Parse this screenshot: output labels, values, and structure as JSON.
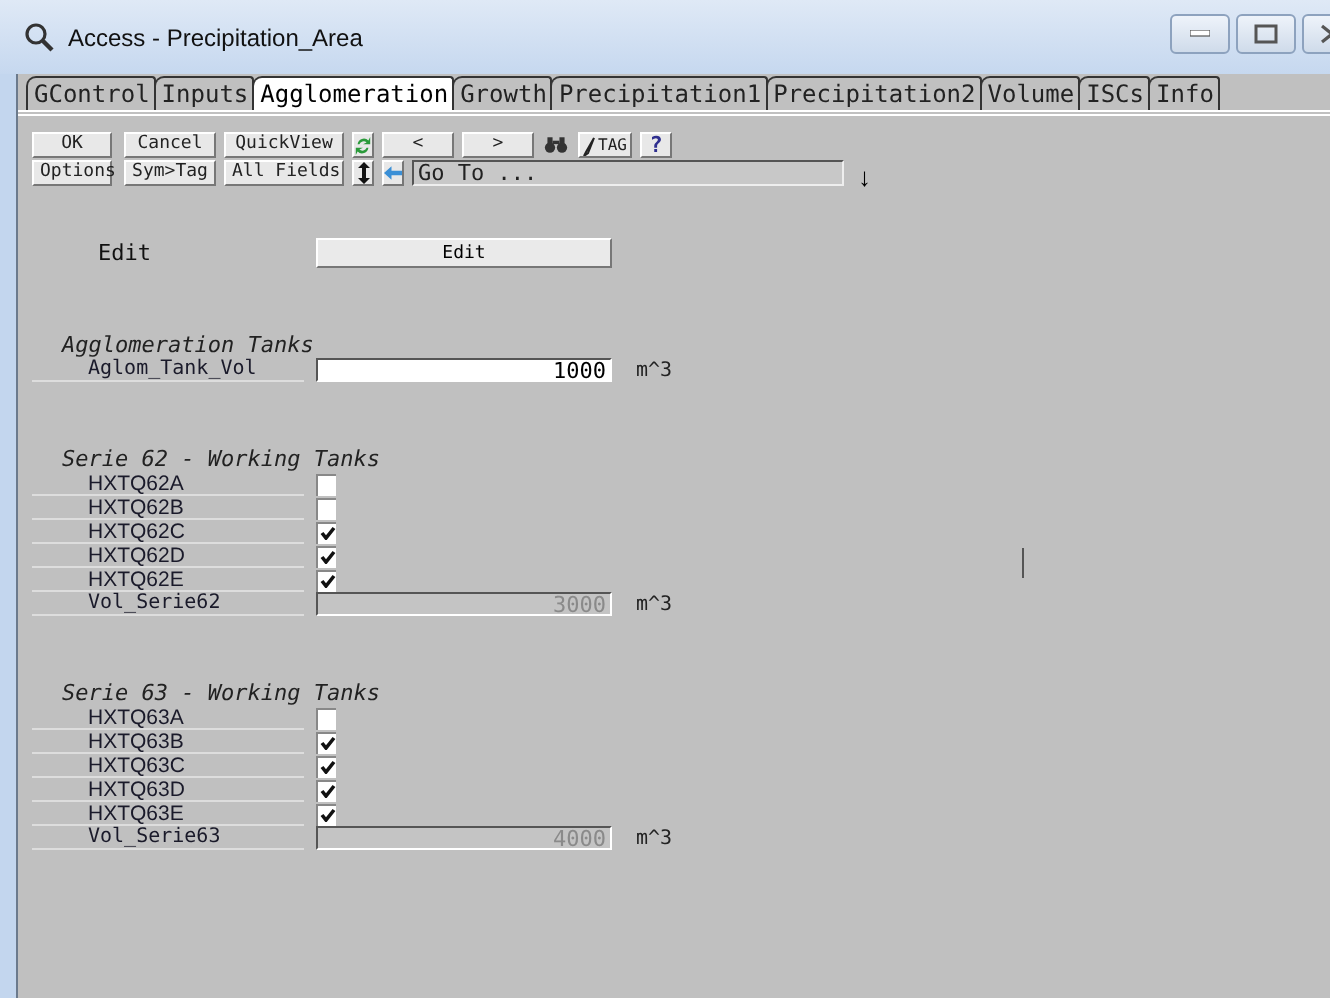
{
  "window": {
    "title": "Access - Precipitation_Area"
  },
  "tabs": [
    {
      "label": "GControl",
      "selected": false
    },
    {
      "label": "Inputs",
      "selected": false
    },
    {
      "label": "Agglomeration",
      "selected": true
    },
    {
      "label": "Growth",
      "selected": false
    },
    {
      "label": "Precipitation1",
      "selected": false
    },
    {
      "label": "Precipitation2",
      "selected": false
    },
    {
      "label": "Volume",
      "selected": false
    },
    {
      "label": "ISCs",
      "selected": false
    },
    {
      "label": "Info",
      "selected": false
    }
  ],
  "toolbar": {
    "row_1": [
      {
        "kind": "text",
        "label": "OK"
      },
      {
        "kind": "text",
        "label": "Cancel"
      },
      {
        "kind": "text",
        "label": "QuickView"
      },
      {
        "kind": "refresh"
      },
      {
        "kind": "text",
        "label": "<"
      },
      {
        "kind": "text",
        "label": ">"
      },
      {
        "kind": "binoculars"
      },
      {
        "kind": "tag",
        "label": "TAG"
      },
      {
        "kind": "help",
        "label": "?"
      }
    ],
    "row_2": [
      {
        "kind": "text",
        "label": "Options"
      },
      {
        "kind": "text",
        "label": "Sym>Tag"
      },
      {
        "kind": "text",
        "label": "All Fields"
      },
      {
        "kind": "updown"
      },
      {
        "kind": "back"
      },
      {
        "kind": "goto",
        "value": "Go To ..."
      },
      {
        "kind": "drop",
        "label": "↓"
      }
    ]
  },
  "edit": {
    "label": "Edit",
    "button": "Edit"
  },
  "sections": [
    {
      "title": "Agglomeration Tanks",
      "rows": [
        {
          "kind": "number",
          "label": "Aglom_Tank_Vol",
          "value": "1000",
          "unit": "m^3",
          "disabled": false
        }
      ]
    },
    {
      "title": "Serie 62 - Working Tanks",
      "rows": [
        {
          "kind": "checkbox",
          "label": "HXTQ62A",
          "checked": false
        },
        {
          "kind": "checkbox",
          "label": "HXTQ62B",
          "checked": false
        },
        {
          "kind": "checkbox",
          "label": "HXTQ62C",
          "checked": true
        },
        {
          "kind": "checkbox",
          "label": "HXTQ62D",
          "checked": true
        },
        {
          "kind": "checkbox",
          "label": "HXTQ62E",
          "checked": true
        },
        {
          "kind": "number",
          "label": "Vol_Serie62",
          "value": "3000",
          "unit": "m^3",
          "disabled": true
        }
      ]
    },
    {
      "title": "Serie 63 - Working Tanks",
      "rows": [
        {
          "kind": "checkbox",
          "label": "HXTQ63A",
          "checked": false
        },
        {
          "kind": "checkbox",
          "label": "HXTQ63B",
          "checked": true
        },
        {
          "kind": "checkbox",
          "label": "HXTQ63C",
          "checked": true
        },
        {
          "kind": "checkbox",
          "label": "HXTQ63D",
          "checked": true
        },
        {
          "kind": "checkbox",
          "label": "HXTQ63E",
          "checked": true
        },
        {
          "kind": "number",
          "label": "Vol_Serie63",
          "value": "4000",
          "unit": "m^3",
          "disabled": true
        }
      ]
    }
  ]
}
